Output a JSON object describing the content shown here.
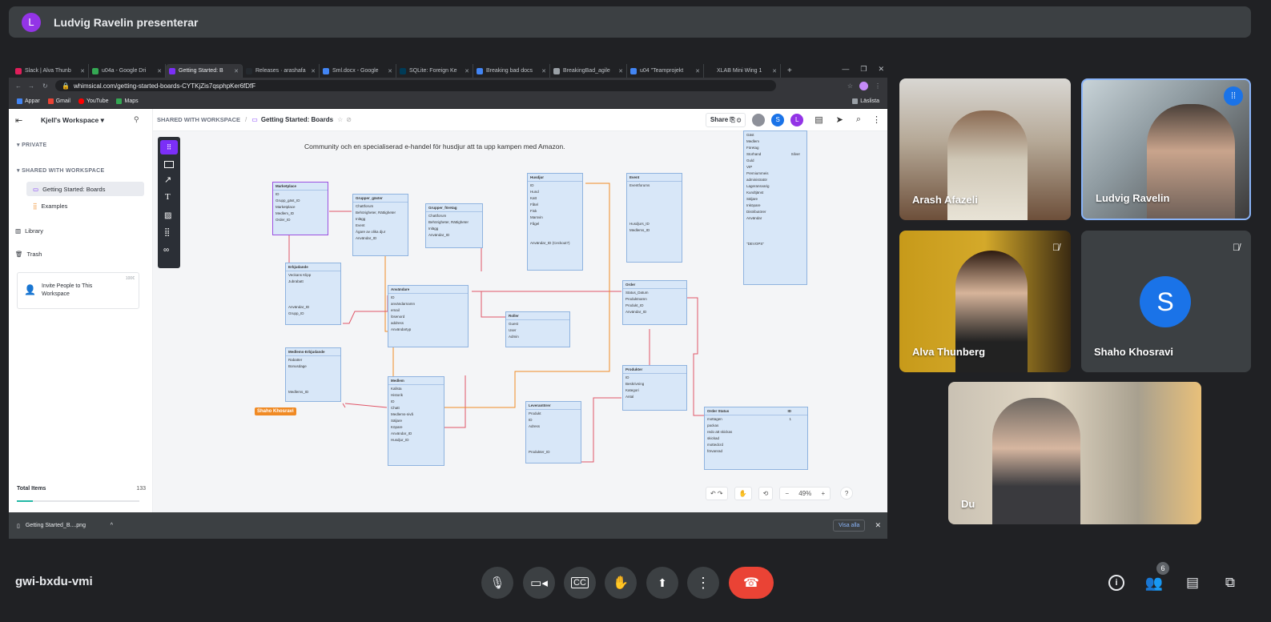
{
  "presenter": {
    "initial": "L",
    "text": "Ludvig Ravelin presenterar"
  },
  "browser": {
    "tabs": [
      {
        "label": "Slack | Alva Thunb",
        "color": "#e01e5a"
      },
      {
        "label": "u04a - Google Dri",
        "color": "#34a853"
      },
      {
        "label": "Getting Started: B",
        "color": "#7b2ff7"
      },
      {
        "label": "Releases · arashafa",
        "color": "#24292e"
      },
      {
        "label": "Sml.docx - Google",
        "color": "#4285f4"
      },
      {
        "label": "SQLite: Foreign Ke",
        "color": "#003b57"
      },
      {
        "label": "Breaking bad docs",
        "color": "#4285f4"
      },
      {
        "label": "BreakingBad_agile",
        "color": "#9aa0a6"
      },
      {
        "label": "u04 \"Teamprojekt",
        "color": "#4285f4"
      },
      {
        "label": "XLAB Mini Wing 1",
        "color": "#202124"
      }
    ],
    "url": "whimsical.com/getting-started-boards-CYTKjZis7qsphpKer6fDfF",
    "bookmarks": [
      "Appar",
      "Gmail",
      "YouTube",
      "Maps"
    ],
    "reading_list": "Läslista"
  },
  "whimsical": {
    "workspace": "Kjell's Workspace",
    "private": "PRIVATE",
    "shared": "SHARED WITH WORKSPACE",
    "board": "Getting Started: Boards",
    "examples": "Examples",
    "library": "Library",
    "trash": "Trash",
    "invite_title": "Invite People to This Workspace",
    "invite_badge": "100€",
    "total_label": "Total Items",
    "total_value": "133",
    "breadcrumb_root": "SHARED WITH WORKSPACE",
    "breadcrumb_sep": "/",
    "share": "Share",
    "zoom": "49%",
    "cursor_label": "Shaho Khosravi",
    "canvas_title": "Community och en specialiserad e-handel för husdjur att ta upp kampen med Amazon.",
    "tables": [
      {
        "title": "Marketplace",
        "rows": [
          "ID",
          "Grupp_gäst_ID",
          "Marketplace",
          "Medlem_ID",
          "Order_ID"
        ]
      },
      {
        "title": "Grupper_gäster",
        "rows": [
          "Chattforum",
          "Behörigheter, Rättigheter",
          "Inlägg",
          "Event",
          "Ägare av olika djur",
          "Användar_ID"
        ]
      },
      {
        "title": "Grupper_företag",
        "rows": [
          "Chattforum",
          "Behörigheter, Rättigheter",
          "Inlägg",
          "Användar_ID"
        ]
      },
      {
        "title": "Husdjur",
        "rows": [
          "ID",
          "Hund",
          "Katt",
          "Fåtel",
          "Fisk",
          "Marsvin",
          "Fågel",
          "",
          "",
          "Användar_ID (Ceckout?)"
        ]
      },
      {
        "title": "Event",
        "rows": [
          "Eventforums",
          "",
          "",
          "",
          "",
          "",
          "Husdjurs_ID",
          "Medlems_ID"
        ]
      },
      {
        "title": "",
        "rows": [
          "Gäst",
          "Medlem",
          "Företag",
          "Storhand",
          "Guld",
          "VIP",
          "Premiummeis",
          "administratör",
          "Lageransvarig",
          "Kundtjänst",
          "Säljare",
          "Inköpare",
          "Distributörer",
          "Användar",
          "",
          "",
          "",
          "\"DEVOPS\""
        ],
        "extra": "Silver"
      },
      {
        "title": "Erbjudande",
        "rows": [
          "Veckans Klipp",
          "Jubrabatt",
          "",
          "",
          "",
          "Användar_ID",
          "Grupp_ID"
        ]
      },
      {
        "title": "Användare",
        "rows": [
          "ID",
          "användarnamn",
          "email",
          "lösenord",
          "address",
          "Användartyp"
        ]
      },
      {
        "title": "Roller",
        "rows": [
          "Guest",
          "User",
          "Admin"
        ]
      },
      {
        "title": "Order",
        "rows": [
          "Status_Datum",
          "Produktnamn",
          "Produkt_ID",
          "Användar_ID"
        ]
      },
      {
        "title": "Medlems-Erbjudande",
        "rows": [
          "Rabatter",
          "Bonusdage",
          "",
          "",
          "",
          "Medlems_ID"
        ]
      },
      {
        "title": "Medlem",
        "rows": [
          "Kallsta",
          "Historik",
          "ID",
          "Chatt",
          "Medlems-nivå",
          "Säljare",
          "Köpare",
          "Användar_ID",
          "Husdjur_ID"
        ]
      },
      {
        "title": "Leverantörer",
        "rows": [
          "Produkt",
          "ID",
          "Adress",
          "",
          "",
          "",
          "Produkter_ID"
        ]
      },
      {
        "title": "Produkter",
        "rows": [
          "ID",
          "Beskrivning",
          "Kategori",
          "Antal"
        ]
      },
      {
        "title": "Order Status",
        "rows": [
          "mottagen",
          "packas",
          "redo att skickas",
          "skickad",
          "mottedcrd",
          "förvanrad"
        ],
        "extra_head": "ID",
        "extra": "1"
      }
    ]
  },
  "download": {
    "file": "Getting Started_B....png",
    "show_all": "Visa alla"
  },
  "participants": [
    {
      "name": "Arash Afazeli"
    },
    {
      "name": "Ludvig Ravelin"
    },
    {
      "name": "Alva Thunberg"
    },
    {
      "name": "Shaho Khosravi",
      "initial": "S"
    },
    {
      "name": "Du"
    }
  ],
  "meeting": {
    "code": "gwi-bxdu-vmi",
    "people_count": "6"
  }
}
